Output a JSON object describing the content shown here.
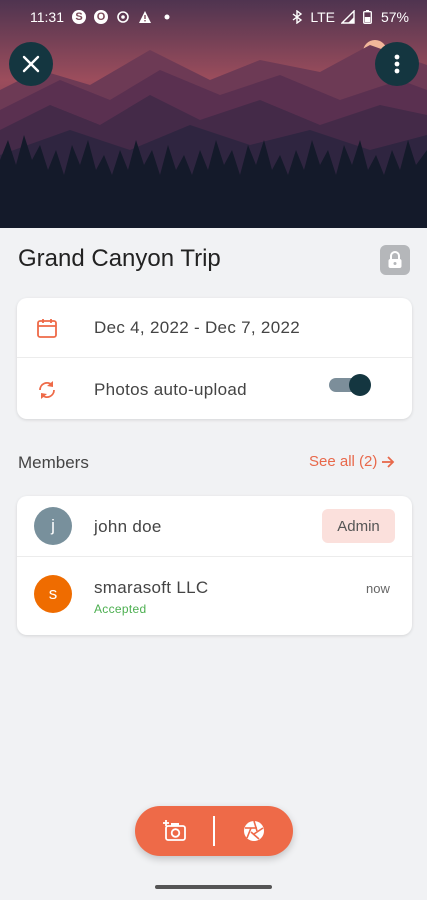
{
  "status_bar": {
    "time": "11:31",
    "network": "LTE",
    "battery": "57%",
    "icons": [
      "skype-icon",
      "office-icon",
      "sync-icon",
      "warning-icon",
      "dot-icon",
      "bluetooth-icon",
      "signal-icon",
      "battery-icon"
    ]
  },
  "header": {
    "close_icon": "close-icon",
    "more_icon": "more-vertical-icon"
  },
  "trip": {
    "title": "Grand Canyon Trip",
    "lock_icon": "lock-icon",
    "date_range": "Dec 4, 2022 - Dec 7, 2022",
    "date_icon": "calendar-icon",
    "auto_upload_label": "Photos auto-upload",
    "auto_upload_icon": "sync-icon",
    "auto_upload_enabled": true
  },
  "members": {
    "section_label": "Members",
    "see_all": "See all (2)",
    "list": [
      {
        "initial": "j",
        "name": "john doe",
        "badge": "Admin",
        "avatar_color": "#78909c"
      },
      {
        "initial": "s",
        "name": "smarasoft LLC",
        "status": "Accepted",
        "time": "now",
        "avatar_color": "#ef6c00"
      }
    ]
  },
  "fab": {
    "left_icon": "add-photo-icon",
    "right_icon": "camera-shutter-icon"
  },
  "colors": {
    "accent": "#ee6a48",
    "dark": "#143640",
    "accepted": "#4caf50",
    "badge_bg": "#fbe0dc"
  }
}
